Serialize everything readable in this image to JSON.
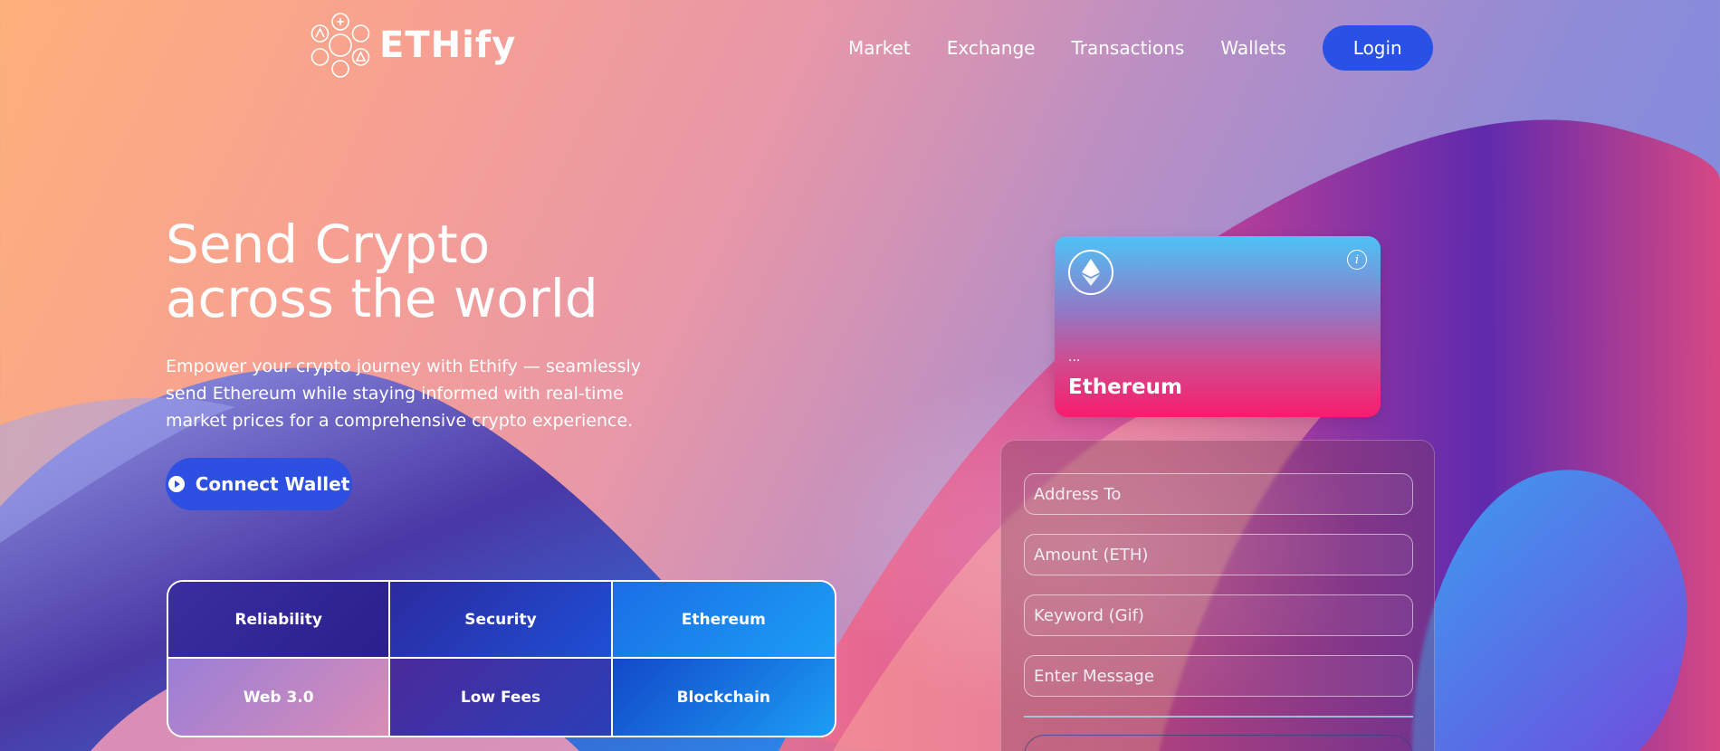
{
  "brand": {
    "name": "ETHify"
  },
  "nav": {
    "links": [
      "Market",
      "Exchange",
      "Transactions",
      "Wallets"
    ],
    "login_label": "Login"
  },
  "hero": {
    "title_line1": "Send Crypto",
    "title_line2": "across the world",
    "description": "Empower your crypto journey with Ethify — seamlessly send Ethereum while staying informed with real-time market prices for a comprehensive crypto experience.",
    "connect_label": "Connect Wallet"
  },
  "features": [
    "Reliability",
    "Security",
    "Ethereum",
    "Web 3.0",
    "Low Fees",
    "Blockchain"
  ],
  "card": {
    "address": "...",
    "name": "Ethereum"
  },
  "form": {
    "address_placeholder": "Address To",
    "amount_placeholder": "Amount (ETH)",
    "keyword_placeholder": "Keyword (Gif)",
    "message_placeholder": "Enter Message"
  },
  "colors": {
    "accent": "#2951e6",
    "card_top": "#4dc3f6",
    "card_bottom": "#f71c6d"
  },
  "icons": [
    "logo-mark-icon",
    "ethereum-icon",
    "info-icon",
    "play-icon"
  ]
}
